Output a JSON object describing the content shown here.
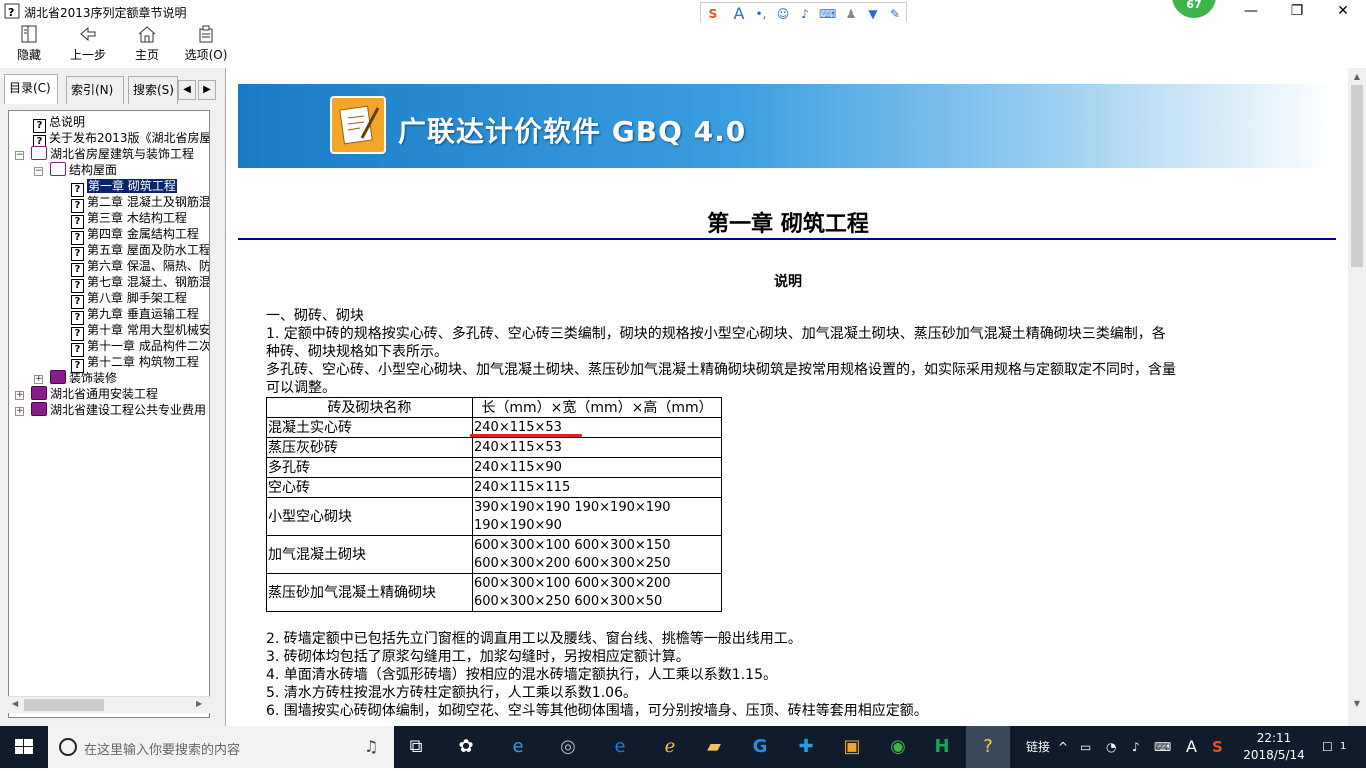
{
  "window": {
    "title": "湖北省2013序列定额章节说明",
    "minimize": "—",
    "restore": "❐",
    "close": "✕"
  },
  "ime_toolbar": {
    "icons": [
      "sogou-icon",
      "font-icon",
      "punct-icon",
      "emoji-icon",
      "mic-icon",
      "keyboard-icon",
      "user-icon",
      "shirt-icon",
      "wrench-icon"
    ]
  },
  "notification_badge": "67",
  "toolbar": {
    "hide": "隐藏",
    "back": "上一步",
    "home": "主页",
    "options": "选项(O)"
  },
  "tabs": {
    "contents": "目录(C)",
    "index": "索引(N)",
    "search": "搜索(S)"
  },
  "tree": [
    {
      "label": "总说明"
    },
    {
      "label": "关于发布2013版《湖北省房屋"
    },
    {
      "label": "湖北省房屋建筑与装饰工程"
    },
    {
      "label": "结构屋面"
    },
    {
      "label": "第一章 砌筑工程"
    },
    {
      "label": "第二章 混凝土及钢筋混"
    },
    {
      "label": "第三章 木结构工程"
    },
    {
      "label": "第四章 金属结构工程"
    },
    {
      "label": "第五章 屋面及防水工程"
    },
    {
      "label": "第六章 保温、隔热、防"
    },
    {
      "label": "第七章 混凝土、钢筋混"
    },
    {
      "label": "第八章 脚手架工程"
    },
    {
      "label": "第九章 垂直运输工程"
    },
    {
      "label": "第十章 常用大型机械安"
    },
    {
      "label": "第十一章 成品构件二次"
    },
    {
      "label": "第十二章 构筑物工程"
    },
    {
      "label": "装饰装修"
    },
    {
      "label": "湖北省通用安装工程"
    },
    {
      "label": "湖北省建设工程公共专业费用"
    }
  ],
  "content": {
    "banner_title": "广联达计价软件 GBQ 4.0",
    "chapter_title": "第一章 砌筑工程",
    "section_title": "说明",
    "p_heading": "一、砌砖、砌块",
    "p1_line1": "1. 定额中砖的规格按实心砖、多孔砖、空心砖三类编制，砌块的规格按小型空心砌块、加气混凝土砌块、蒸压砂加气混凝土精确砌块三类编制，各",
    "p1_line2": "种砖、砌块规格如下表所示。",
    "p2_line1": "多孔砖、空心砖、小型空心砌块、加气混凝土砌块、蒸压砂加气混凝土精确砌块砌筑是按常用规格设置的，如实际采用规格与定额取定不同时，含量",
    "p2_line2": "可以调整。",
    "table": {
      "headers": [
        "砖及砌块名称",
        "长（mm）×宽（mm）×高（mm）"
      ],
      "rows": [
        {
          "name": "混凝土实心砖",
          "spec1": "240×115×53",
          "spec2": ""
        },
        {
          "name": "蒸压灰砂砖",
          "spec1": "240×115×53",
          "spec2": ""
        },
        {
          "name": "多孔砖",
          "spec1": "240×115×90",
          "spec2": ""
        },
        {
          "name": "空心砖",
          "spec1": "240×115×115",
          "spec2": ""
        },
        {
          "name": "小型空心砌块",
          "spec1": "390×190×190 190×190×190",
          "spec2": "190×190×90"
        },
        {
          "name": "加气混凝土砌块",
          "spec1": "600×300×100 600×300×150",
          "spec2": "600×300×200 600×300×250"
        },
        {
          "name": "蒸压砂加气混凝土精确砌块",
          "spec1": "600×300×100 600×300×200",
          "spec2": "600×300×250 600×300×50"
        }
      ]
    },
    "notes": [
      "2. 砖墙定额中已包括先立门窗框的调直用工以及腰线、窗台线、挑檐等一般出线用工。",
      "3. 砖砌体均包括了原浆勾缝用工，加浆勾缝时，另按相应定额计算。",
      "4. 单面清水砖墙（含弧形砖墙）按相应的混水砖墙定额执行，人工乘以系数1.15。",
      "5. 清水方砖柱按混水方砖柱定额执行，人工乘以系数1.06。",
      "6. 围墙按实心砖砌体编制，如砌空花、空斗等其他砌体围墙，可分别按墙身、压顶、砖柱等套用相应定额。"
    ]
  },
  "taskbar": {
    "search_placeholder": "在这里输入你要搜索的内容",
    "tray_link": "链接",
    "tray_ime": "A",
    "time": "22:11",
    "date": "2018/5/14",
    "notifications": "1"
  }
}
